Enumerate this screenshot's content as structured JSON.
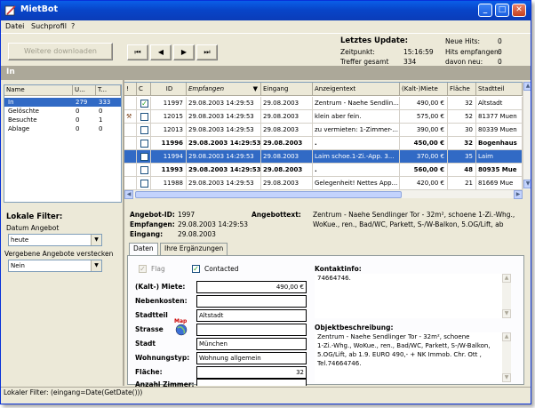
{
  "window": {
    "title": "MietBot"
  },
  "menu": [
    "Datei",
    "Suchprofil",
    "?"
  ],
  "toolbar": {
    "download_label": "Weitere downloaden",
    "nav": [
      "⏮",
      "◀",
      "▶",
      "⏭"
    ]
  },
  "update": {
    "title": "Letztes Update:",
    "time_label": "Zeitpunkt:",
    "time_value": "15:16:59",
    "total_label": "Treffer gesamt",
    "total_value": "334",
    "newhits_label": "Neue Hits:",
    "newhits_value": "0",
    "hitsrecv_label": "Hits empfangen:",
    "hitsrecv_value": "0",
    "newof_label": "davon neu:",
    "newof_value": "0"
  },
  "band": {
    "label": "In"
  },
  "folders": {
    "headers": [
      "Name",
      "U...",
      "T..."
    ],
    "rows": [
      {
        "name": "In",
        "u": "279",
        "t": "333"
      },
      {
        "name": "Gelöschte",
        "u": "0",
        "t": "0"
      },
      {
        "name": "Besuchte",
        "u": "0",
        "t": "1"
      },
      {
        "name": "Ablage",
        "u": "0",
        "t": "0"
      }
    ]
  },
  "filter": {
    "title": "Lokale Filter:",
    "date_label": "Datum Angebot",
    "date_value": "heute",
    "hide_label": "Vergebene Angebote verstecken",
    "hide_value": "Nein"
  },
  "grid": {
    "headers": [
      "!",
      "C",
      "ID",
      "Empfangen",
      "Eingang",
      "Anzeigentext",
      "(Kalt-)Miete",
      "Fläche",
      "Stadtteil"
    ],
    "rows": [
      {
        "flag": "",
        "checked": true,
        "id": "11997",
        "recv": "29.08.2003 14:29:53",
        "in": "29.08.2003",
        "text": "Zentrum - Naehe Sendlin...",
        "rent": "490,00 €",
        "area": "32",
        "district": "Altstadt",
        "bold": false,
        "sel": false
      },
      {
        "flag": "",
        "checked": false,
        "id": "12015",
        "recv": "29.08.2003 14:29:53",
        "in": "29.08.2003",
        "text": "klein aber fein.",
        "rent": "575,00 €",
        "area": "52",
        "district": "81377 Muen",
        "bold": false,
        "sel": false
      },
      {
        "flag": "",
        "checked": false,
        "id": "12013",
        "recv": "29.08.2003 14:29:53",
        "in": "29.08.2003",
        "text": "zu vermieten: 1-Zimmer-...",
        "rent": "390,00 €",
        "area": "30",
        "district": "80339 Muen",
        "bold": false,
        "sel": false
      },
      {
        "flag": "",
        "checked": false,
        "id": "11996",
        "recv": "29.08.2003 14:29:53",
        "in": "29.08.2003",
        "text": ".",
        "rent": "450,00 €",
        "area": "32",
        "district": "Bogenhaus",
        "bold": true,
        "sel": false
      },
      {
        "flag": "",
        "checked": false,
        "id": "11994",
        "recv": "29.08.2003 14:29:53",
        "in": "29.08.2003",
        "text": "Laim schoe.1-Zi.-App. 3...",
        "rent": "370,00 €",
        "area": "35",
        "district": "Laim",
        "bold": false,
        "sel": true
      },
      {
        "flag": "",
        "checked": false,
        "id": "11993",
        "recv": "29.08.2003 14:29:53",
        "in": "29.08.2003",
        "text": ".",
        "rent": "560,00 €",
        "area": "48",
        "district": "80935 Mue",
        "bold": true,
        "sel": false
      },
      {
        "flag": "",
        "checked": false,
        "id": "11988",
        "recv": "29.08.2003 14:29:53",
        "in": "29.08.2003",
        "text": "Gelegenheit! Nettes App...",
        "rent": "420,00 €",
        "area": "21",
        "district": "81669 Mue",
        "bold": false,
        "sel": false
      }
    ]
  },
  "detail": {
    "id_label": "Angebot-ID:",
    "id_value": "1997",
    "recv_label": "Empfangen:",
    "recv_value": "29.08.2003 14:29:53",
    "in_label": "Eingang:",
    "in_value": "29.08.2003",
    "text_label": "Angebottext:",
    "text_value_1": "Zentrum - Naehe Sendlinger Tor - 32m², schoene 1-Zi.-Whg.,",
    "text_value_2": "WoKue., ren., Bad/WC, Parkett, S-/W-Balkon, 5.OG/Lift, ab",
    "tabs": [
      "Daten",
      "Ihre Ergänzungen"
    ],
    "flag_label": "Flag",
    "contacted_label": "Contacted",
    "rent_label": "(Kalt-) Miete:",
    "rent_value": "490,00 €",
    "extra_label": "Nebenkosten:",
    "extra_value": "",
    "district_label": "Stadtteil",
    "district_value": "Altstadt",
    "street_label": "Strasse",
    "street_value": "",
    "map_label": "Map",
    "city_label": "Stadt",
    "city_value": "München",
    "type_label": "Wohnungstyp:",
    "type_value": "Wohnung allgemein",
    "area_label": "Fläche:",
    "area_value": "32",
    "rooms_label": "Anzahl Zimmer:",
    "rooms_value": "",
    "contact_label": "Kontaktinfo:",
    "contact_value": "74664746.",
    "desc_label": "Objektbeschreibung:",
    "desc_lines": [
      "Zentrum - Naehe Sendlinger Tor - 32m², schoene",
      "1-Zi.-Whg., WoKue., ren., Bad/WC, Parkett, S-/W-Balkon,",
      "5.OG/Lift, ab 1.9. EURO 490,- + NK Immob. Chr. Ott ,",
      "Tel.74664746."
    ]
  },
  "status": {
    "text": "Lokaler Filter: (eingang=Date(GetDate()))"
  }
}
